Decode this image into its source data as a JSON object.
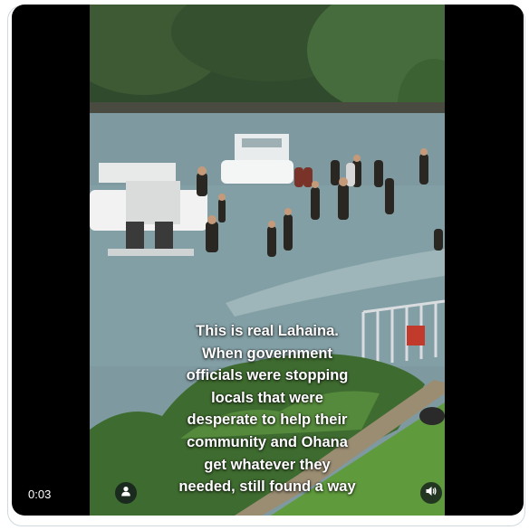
{
  "video": {
    "timestamp": "0:03",
    "caption_lines": [
      "This is real Lahaina.",
      "When government",
      "officials were stopping",
      "locals that were",
      "desperate to help their",
      "community and Ohana",
      "get whatever they",
      "needed, still found a way"
    ]
  },
  "controls": {
    "avatar_icon": "person-icon",
    "volume_icon": "speaker-volume-icon"
  },
  "colors": {
    "player_background": "#000000",
    "control_background": "#0f1419",
    "card_border": "#cfd9de",
    "caption_text": "#ffffff"
  }
}
